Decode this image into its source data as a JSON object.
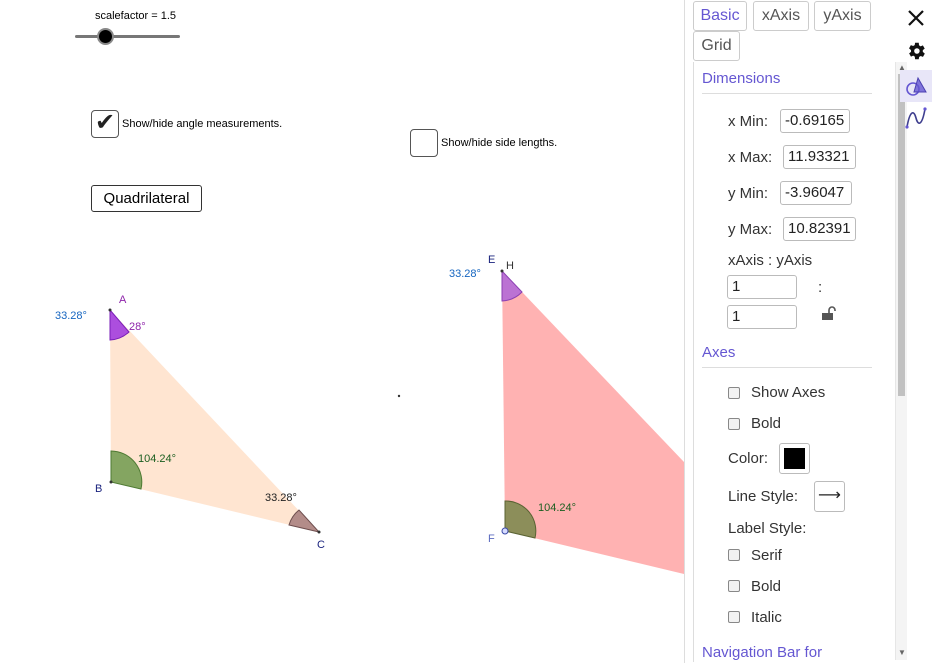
{
  "graphics": {
    "slider": {
      "label": "scalefactor = 1.5",
      "value": 1.5
    },
    "angle_checkbox": {
      "label": "Show/hide angle measurements.",
      "checked": true
    },
    "side_checkbox": {
      "label": "Show/hide side lengths.",
      "checked": false
    },
    "button": {
      "label": "Quadrilateral"
    },
    "triangle1": {
      "vertex_a": "A",
      "vertex_b": "B",
      "vertex_c": "C",
      "angle_a": "33.28°",
      "angle_a_partial": "28°",
      "angle_b": "104.24°",
      "angle_c": "33.28°"
    },
    "triangle2": {
      "vertex_e": "E",
      "vertex_h": "H",
      "vertex_f": "F",
      "angle_e": "33.28°",
      "angle_f": "104.24°"
    }
  },
  "settings": {
    "tabs": [
      "Basic",
      "xAxis",
      "yAxis",
      "Grid"
    ],
    "active_tab": "Basic",
    "dimensions": {
      "title": "Dimensions",
      "x_min_label": "x Min:",
      "x_min": "-0.69165",
      "x_max_label": "x Max:",
      "x_max": "11.93321",
      "y_min_label": "y Min:",
      "y_min": "-3.96047",
      "y_max_label": "y Max:",
      "y_max": "10.82391",
      "ratio_label": "xAxis : yAxis",
      "ratio_x": "1",
      "ratio_sep": ":",
      "ratio_y": "1"
    },
    "axes": {
      "title": "Axes",
      "show_axes": "Show Axes",
      "bold": "Bold",
      "color_label": "Color:",
      "color": "#000000",
      "line_style_label": "Line Style:",
      "line_style_glyph": "⟶",
      "label_style_label": "Label Style:",
      "serif": "Serif",
      "bold2": "Bold",
      "italic": "Italic"
    },
    "nav_title": "Navigation Bar for"
  },
  "colors": {
    "accent": "#6557d2",
    "triangle1_fill": "#ffe5d1",
    "triangle2_fill": "#ffb2b2",
    "angle_a_fill": "#9e34e0",
    "angle_b_fill": "#6f9a4e",
    "angle_c_fill": "#a67d7d",
    "label_blue": "#1565c0",
    "label_purple": "#8e24aa",
    "label_green": "#1b5e20"
  }
}
